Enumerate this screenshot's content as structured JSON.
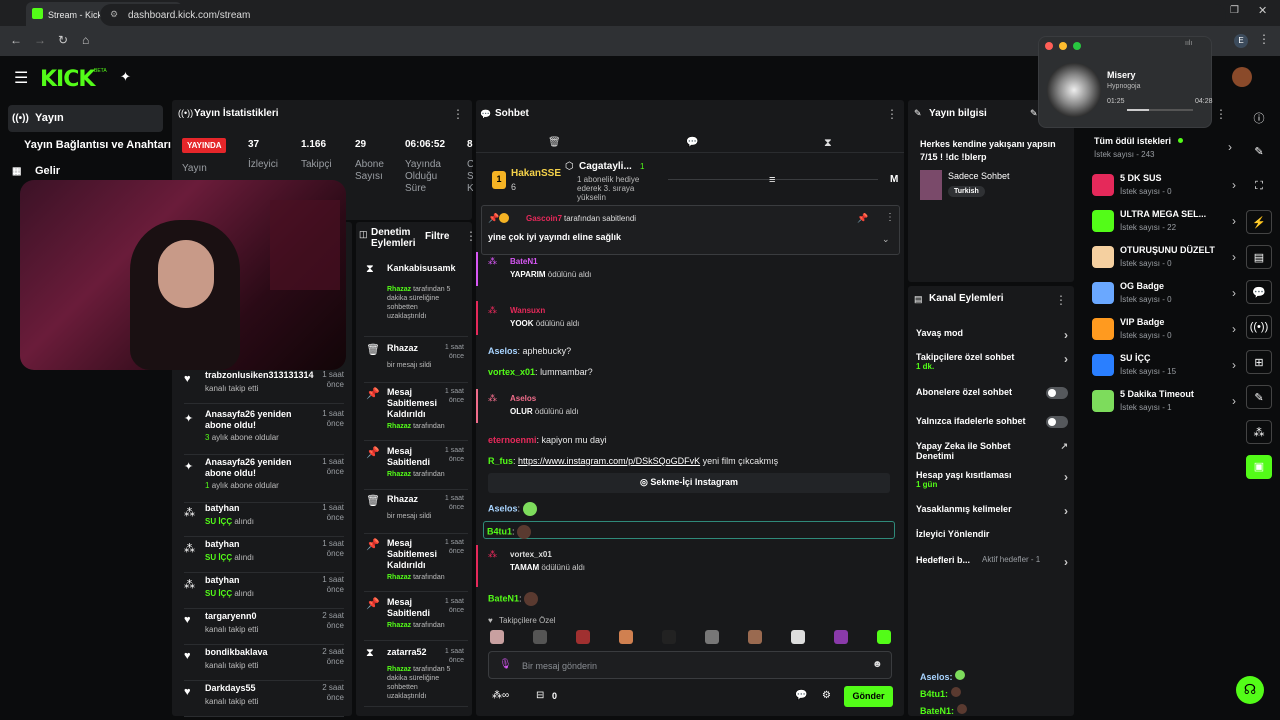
{
  "browser": {
    "tab_title": "Stream - Kick Dashboard",
    "url": "dashboard.kick.com/stream",
    "profile": "E"
  },
  "brand": {
    "logo": "KICK",
    "beta": "BETA",
    "accent": "#53fc18"
  },
  "sidebar": {
    "items": [
      {
        "label": "Yayın"
      },
      {
        "label": "Yayın Bağlantısı ve Anahtarı"
      },
      {
        "label": "Gelir"
      }
    ]
  },
  "stats": {
    "title": "Yayın İstatistikleri",
    "live_badge": "YAYINDA",
    "live_label": "Yayın",
    "viewers": {
      "value": "37",
      "label": "İzleyici"
    },
    "followers": {
      "value": "1.166",
      "label": "Takipçi"
    },
    "subs": {
      "value": "29",
      "label": "Abone Sayısı"
    },
    "uptime": {
      "value": "06:06:52",
      "label": "Yayında Olduğu Süre"
    },
    "extra": {
      "value": "8",
      "label": "C S K"
    }
  },
  "activity": [
    {
      "name": "trabzonlusiken313131314",
      "sub": "kanalı takip etti",
      "time": "1 saat önce",
      "icon": "heart-icon"
    },
    {
      "name": "Anasayfa26 yeniden abone oldu!",
      "sub": "aylık abone oldular",
      "sub_num": "3",
      "time": "1 saat önce",
      "icon": "sparkle-icon"
    },
    {
      "name": "Anasayfa26 yeniden abone oldu!",
      "sub": "aylık abone oldular",
      "sub_num": "1",
      "time": "1 saat önce",
      "icon": "sparkle-icon"
    },
    {
      "name": "batyhan",
      "sub_green": "SU İÇÇ",
      "sub": "alındı",
      "time": "1 saat önce",
      "icon": "reward-icon"
    },
    {
      "name": "batyhan",
      "sub_green": "SU İÇÇ",
      "sub": "alındı",
      "time": "1 saat önce",
      "icon": "reward-icon"
    },
    {
      "name": "batyhan",
      "sub_green": "SU İÇÇ",
      "sub": "alındı",
      "time": "1 saat önce",
      "icon": "reward-icon"
    },
    {
      "name": "targaryenn0",
      "sub": "kanalı takip etti",
      "time": "2 saat önce",
      "icon": "heart-icon"
    },
    {
      "name": "bondikbaklava",
      "sub": "kanalı takip etti",
      "time": "2 saat önce",
      "icon": "heart-icon"
    },
    {
      "name": "Darkdays55",
      "sub": "kanalı takip etti",
      "time": "2 saat önce",
      "icon": "heart-icon"
    }
  ],
  "moderation": {
    "title": "Denetim Eylemleri",
    "filter": "Filtre",
    "items": [
      {
        "title": "Kankabisusamk",
        "by": "Rhazaz",
        "desc": "tarafından 5 dakika süreliğine sohbetten uzaklaştırıldı",
        "time": ""
      },
      {
        "title": "Rhazaz",
        "desc": "bir mesajı sildi",
        "time": "1 saat önce"
      },
      {
        "title": "Mesaj Sabitlemesi Kaldırıldı",
        "by": "Rhazaz",
        "desc": "tarafından",
        "time": "1 saat önce"
      },
      {
        "title": "Mesaj Sabitlendi",
        "by": "Rhazaz",
        "desc": "tarafından",
        "time": "1 saat önce"
      },
      {
        "title": "Rhazaz",
        "desc": "bir mesajı sildi",
        "time": "1 saat önce"
      },
      {
        "title": "Mesaj Sabitlemesi Kaldırıldı",
        "by": "Rhazaz",
        "desc": "tarafından",
        "time": "1 saat önce"
      },
      {
        "title": "Mesaj Sabitlendi",
        "by": "Rhazaz",
        "desc": "tarafından",
        "time": "1 saat önce"
      },
      {
        "title": "zatarra52",
        "by": "Rhazaz",
        "desc": "tarafından 5 dakika süreliğine sohbetten uzaklaştırıldı",
        "time": "1 saat önce"
      }
    ]
  },
  "chat": {
    "title": "Sohbet",
    "top_gifter": {
      "name": "HakanSSE",
      "rank": "1",
      "count": "6"
    },
    "gift_goal": {
      "name": "Cagatayli...",
      "num": "1",
      "desc": "1 abonelik hediye ederek 3. sıraya yükselin"
    },
    "right_letter": "M",
    "pinned": {
      "by": "Gascoin7",
      "by_suffix": "tarafından sabitlendi",
      "text": "yine çok iyi yayındı eline sağlık"
    },
    "messages": [
      {
        "type": "reward",
        "user": "BateN1",
        "reward": "YAPARIM",
        "suffix": "ödülünü aldı",
        "color": "#d657f3"
      },
      {
        "type": "reward",
        "user": "Wansuxn",
        "reward": "YOOK",
        "suffix": "ödülünü aldı",
        "color": "#e5295a"
      },
      {
        "type": "text",
        "user": "Aselos",
        "text": "aphebucky?",
        "color": "#a8d4ff"
      },
      {
        "type": "text",
        "user": "vortex_x01",
        "text": "lummambar?",
        "color": "#53fc18"
      },
      {
        "type": "reward",
        "user": "Aselos",
        "reward": "OLUR",
        "suffix": "ödülünü aldı",
        "color": "#f06d8b"
      },
      {
        "type": "text",
        "user": "eternoenmi",
        "text": "kapiyon mu dayi",
        "color": "#e5295a"
      },
      {
        "type": "link",
        "user": "R_fus",
        "link": "https://www.instagram.com/p/DSkSQoGDFvK",
        "text": "yeni film çıkcakmış",
        "color": "#53fc18"
      },
      {
        "type": "embed",
        "label": "Sekme-İçi Instagram"
      },
      {
        "type": "text",
        "user": "Aselos",
        "text": "",
        "color": "#a8d4ff"
      },
      {
        "type": "text",
        "user": "B4tu1",
        "text": "",
        "color": "#53fc18"
      },
      {
        "type": "reward",
        "user": "vortex_x01",
        "reward": "TAMAM",
        "suffix": "ödülünü aldı",
        "color": "#e5295a"
      },
      {
        "type": "text",
        "user": "BateN1",
        "text": "",
        "color": "#53fc18"
      }
    ],
    "followers_only": "Takipçilere Özel",
    "input_placeholder": "Bir mesaj gönderin",
    "points": "0",
    "send": "Gönder"
  },
  "stream_info": {
    "title": "Yayın bilgisi",
    "stream_title": "Herkes kendine yakışanı yapsın 7/15 ! !dc !blerp",
    "category": "Sadece Sohbet",
    "tag": "Turkish"
  },
  "channel_actions": {
    "title": "Kanal Eylemleri",
    "items": [
      {
        "label": "Yavaş mod",
        "control": "arrow"
      },
      {
        "label": "Takipçilere özel sohbet",
        "sub": "1 dk.",
        "control": "arrow"
      },
      {
        "label": "Abonelere özel sohbet",
        "control": "toggle"
      },
      {
        "label": "Yalnızca ifadelerle sohbet",
        "control": "toggle"
      },
      {
        "label": "Yapay Zeka ile Sohbet Denetimi",
        "control": "external"
      },
      {
        "label": "Hesap yaşı kısıtlaması",
        "sub": "1 gün",
        "control": "arrow"
      },
      {
        "label": "Yasaklanmış kelimeler",
        "control": "arrow"
      },
      {
        "label": "İzleyici Yönlendir",
        "control": "none"
      },
      {
        "label": "Hedefleri b...",
        "sub": "Aktif hedefler - 1",
        "control": "arrow"
      }
    ]
  },
  "mini_chat": [
    {
      "user": "Aselos"
    },
    {
      "user": "B4tu1"
    },
    {
      "user": "BateN1"
    }
  ],
  "rewards": {
    "all_label": "Tüm ödül istekleri",
    "all_count": "İstek sayısı - 243",
    "items": [
      {
        "name": "5 DK SUS",
        "count": "İstek sayısı - 0",
        "color": "#e5295a"
      },
      {
        "name": "ULTRA MEGA SEL...",
        "count": "İstek sayısı - 22",
        "color": "#53fc18"
      },
      {
        "name": "OTURUŞUNU DÜZELT",
        "count": "İstek sayısı - 0",
        "color": "#f5d0a0"
      },
      {
        "name": "OG Badge",
        "count": "İstek sayısı - 0",
        "color": "#6aa8ff"
      },
      {
        "name": "VIP Badge",
        "count": "İstek sayısı - 0",
        "color": "#ff9a1f"
      },
      {
        "name": "SU İÇÇ",
        "count": "İstek sayısı - 15",
        "color": "#2a7fff"
      },
      {
        "name": "5 Dakika Timeout",
        "count": "İstek sayısı - 1",
        "color": "#7ddc5c"
      }
    ]
  },
  "media": {
    "track": "Misery",
    "artist": "Hypnogoja",
    "elapsed": "01:25",
    "total": "04:28",
    "progress": 0.33
  }
}
